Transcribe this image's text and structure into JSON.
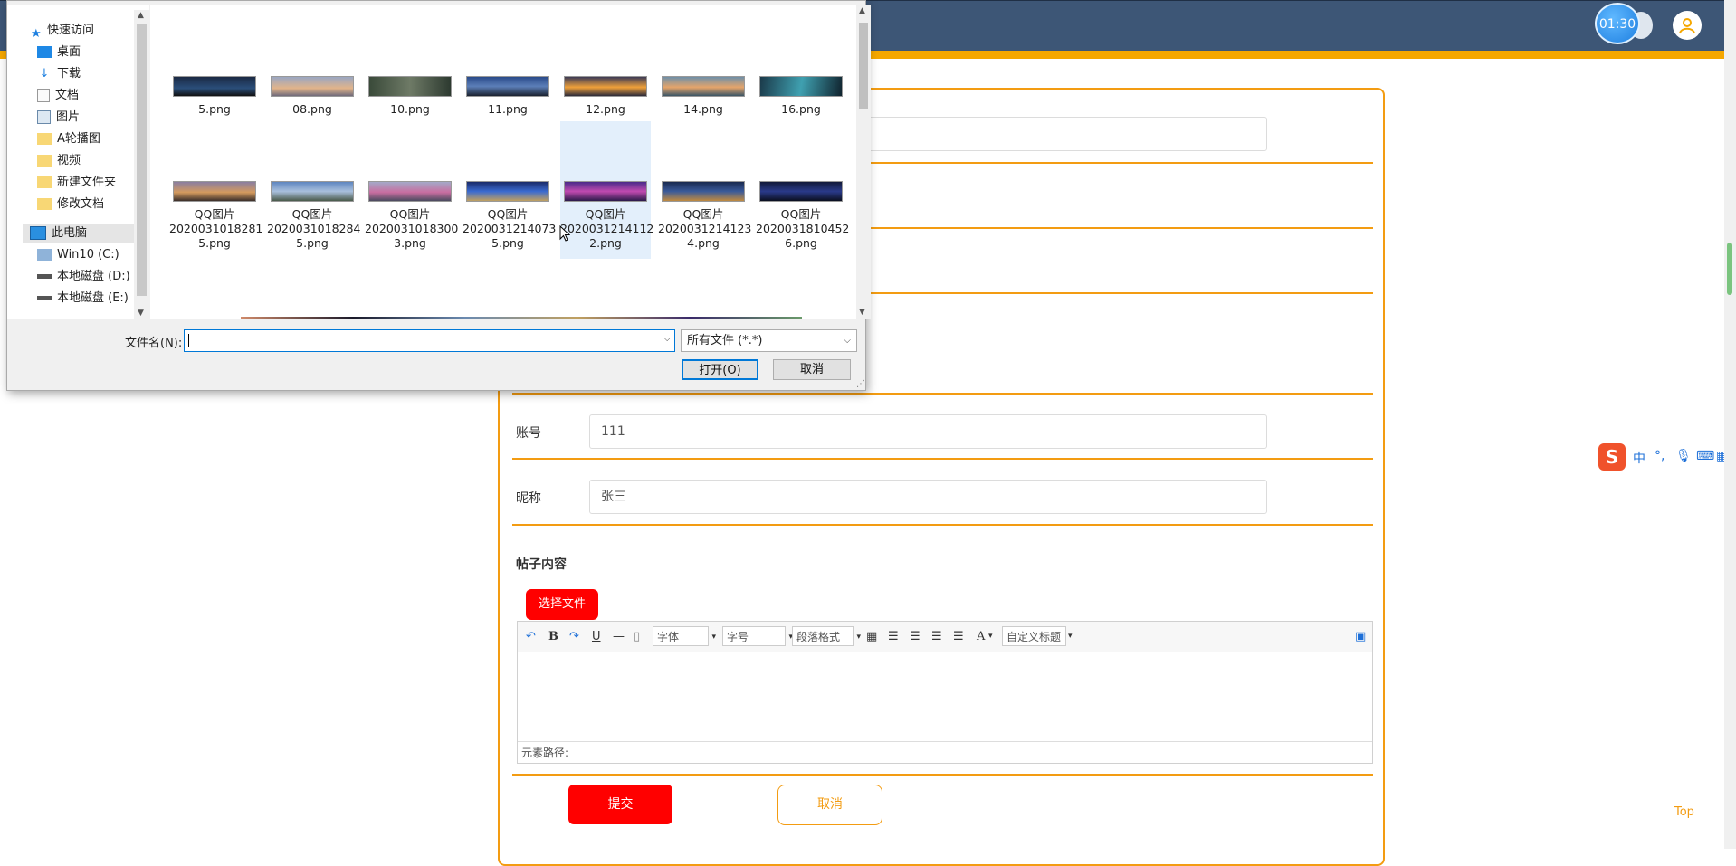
{
  "header": {
    "timer": "01:30"
  },
  "form": {
    "account_label": "账号",
    "account_value": "111",
    "nickname_label": "昵称",
    "nickname_value": "张三",
    "content_label": "帖子内容",
    "choose_file_label": "选择文件",
    "submit_label": "提交",
    "cancel_label": "取消"
  },
  "editor": {
    "font_select": "字体",
    "size_select": "字号",
    "paragraph_select": "段落格式",
    "custom_title_select": "自定义标题",
    "bold": "B",
    "underline": "U",
    "font_color": "A",
    "path_label": "元素路径:"
  },
  "ime": {
    "logo": "S",
    "lang": "中"
  },
  "top_link": "Top",
  "dialog": {
    "nav": {
      "quick_access": "快速访问",
      "items": [
        "桌面",
        "下载",
        "文档",
        "图片",
        "A轮播图",
        "视频",
        "新建文件夹",
        "修改文档"
      ],
      "this_pc": "此电脑",
      "drives": [
        "Win10 (C:)",
        "本地磁盘 (D:)",
        "本地磁盘 (E:)"
      ]
    },
    "files_row1": [
      "5.png",
      "08.png",
      "10.png",
      "11.png",
      "12.png",
      "14.png",
      "16.png"
    ],
    "files_row2": [
      {
        "l1": "QQ图片",
        "l2": "2020031018281",
        "l3": "5.png"
      },
      {
        "l1": "QQ图片",
        "l2": "2020031018284",
        "l3": "5.png"
      },
      {
        "l1": "QQ图片",
        "l2": "2020031018300",
        "l3": "3.png"
      },
      {
        "l1": "QQ图片",
        "l2": "2020031214073",
        "l3": "5.png"
      },
      {
        "l1": "QQ图片",
        "l2": "2020031214112",
        "l3": "2.png"
      },
      {
        "l1": "QQ图片",
        "l2": "2020031214123",
        "l3": "4.png"
      },
      {
        "l1": "QQ图片",
        "l2": "2020031810452",
        "l3": "6.png"
      }
    ],
    "filename_label": "文件名(N):",
    "filename_value": "",
    "filetype": "所有文件 (*.*)",
    "open_label": "打开(O)",
    "cancel_label": "取消"
  }
}
